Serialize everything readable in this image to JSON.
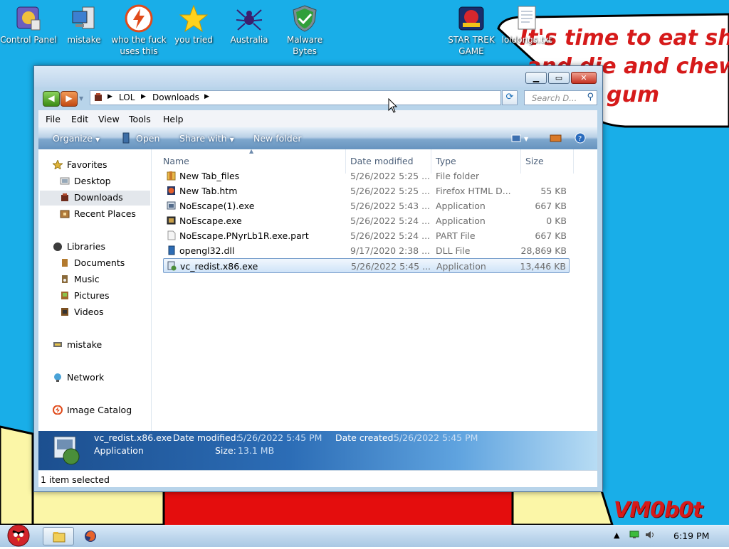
{
  "desktop": {
    "icons": [
      {
        "label": "Control Panel",
        "icon": "control-panel-icon"
      },
      {
        "label": "mistake",
        "icon": "computer-icon"
      },
      {
        "label": "who the fuck uses this",
        "icon": "flashget-icon"
      },
      {
        "label": "you tried",
        "icon": "star-icon"
      },
      {
        "label": "Australia",
        "icon": "spider-icon"
      },
      {
        "label": "Malware Bytes",
        "icon": "shield-icon"
      },
      {
        "label": "STAR TREK GAME",
        "icon": "star-trek-icon"
      },
      {
        "label": "loldongs.txt",
        "icon": "text-file-icon"
      }
    ],
    "bubble_text": [
      "It's time to eat shit",
      "and die and chew",
      "gum"
    ],
    "signature": "VM0b0t"
  },
  "window": {
    "breadcrumb": [
      "LOL",
      "Downloads"
    ],
    "search_placeholder": "Search D...",
    "menu": [
      "File",
      "Edit",
      "View",
      "Tools",
      "Help"
    ],
    "toolbar": {
      "organize": "Organize",
      "open": "Open",
      "share_with": "Share with",
      "new_folder": "New folder"
    },
    "nav": {
      "favorites": "Favorites",
      "favorites_items": [
        "Desktop",
        "Downloads",
        "Recent Places"
      ],
      "libraries": "Libraries",
      "libraries_items": [
        "Documents",
        "Music",
        "Pictures",
        "Videos"
      ],
      "computer": "mistake",
      "network": "Network",
      "image_catalog": "Image Catalog"
    },
    "columns": [
      "Name",
      "Date modified",
      "Type",
      "Size"
    ],
    "files": [
      {
        "name": "New Tab_files",
        "date": "5/26/2022 5:25 ...",
        "type": "File folder",
        "size": "",
        "icon": "folder-icon"
      },
      {
        "name": "New Tab.htm",
        "date": "5/26/2022 5:25 ...",
        "type": "Firefox HTML D...",
        "size": "55 KB",
        "icon": "firefox-html-icon"
      },
      {
        "name": "NoEscape(1).exe",
        "date": "5/26/2022 5:43 ...",
        "type": "Application",
        "size": "667 KB",
        "icon": "exe-icon"
      },
      {
        "name": "NoEscape.exe",
        "date": "5/26/2022 5:24 ...",
        "type": "Application",
        "size": "0 KB",
        "icon": "exe-icon"
      },
      {
        "name": "NoEscape.PNyrLb1R.exe.part",
        "date": "5/26/2022 5:24 ...",
        "type": "PART File",
        "size": "667 KB",
        "icon": "part-file-icon"
      },
      {
        "name": "opengl32.dll",
        "date": "9/17/2020 2:38 ...",
        "type": "DLL File",
        "size": "28,869 KB",
        "icon": "dll-icon"
      },
      {
        "name": "vc_redist.x86.exe",
        "date": "5/26/2022 5:45 ...",
        "type": "Application",
        "size": "13,446 KB",
        "icon": "installer-icon"
      }
    ],
    "selected_row_index": 6,
    "details": {
      "filename": "vc_redist.x86.exe",
      "type": "Application",
      "date_modified_label": "Date modified:",
      "date_modified": "5/26/2022 5:45 PM",
      "date_created_label": "Date created:",
      "date_created": "5/26/2022 5:45 PM",
      "size_label": "Size:",
      "size": "13.1 MB"
    },
    "status": "1 item selected"
  },
  "taskbar": {
    "clock": "6:19 PM"
  },
  "colors": {
    "desktop_bg": "#19aee8",
    "bubble_text": "#d61a1a",
    "selection": "#cfe3f8"
  }
}
